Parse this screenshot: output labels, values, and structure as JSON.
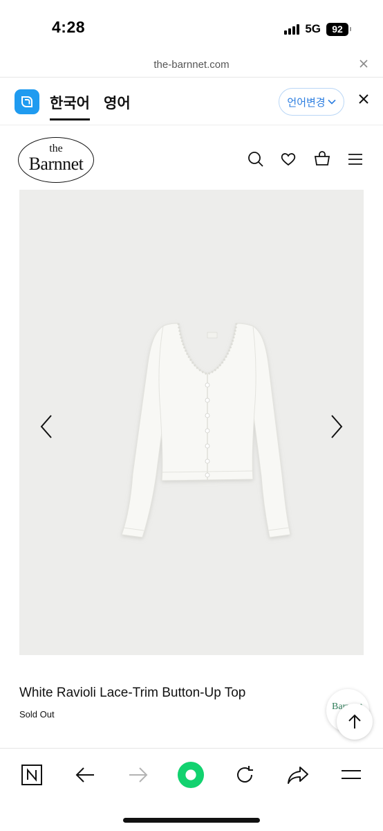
{
  "status_bar": {
    "time": "4:28",
    "network": "5G",
    "battery": "92"
  },
  "url_bar": {
    "url": "the-barnnet.com"
  },
  "translate_bar": {
    "source_language": "한국어",
    "target_language": "영어",
    "change_language_label": "언어변경",
    "accent_color": "#2b7de0"
  },
  "site": {
    "logo_small": "the",
    "logo_main": "Barnnet",
    "icons": [
      "search-icon",
      "heart-icon",
      "bag-icon",
      "menu-icon"
    ]
  },
  "product": {
    "title": "White Ravioli Lace-Trim Button-Up Top",
    "status": "Sold Out",
    "image_background": "#ededeb"
  },
  "float_chip": {
    "logo_text": "Barnnet"
  },
  "toolbar": {
    "items": [
      "naver-n-icon",
      "back-arrow-icon",
      "forward-arrow-icon",
      "green-dot-home-icon",
      "refresh-icon",
      "share-icon",
      "menu-icon"
    ],
    "home_color": "#12d26f"
  }
}
